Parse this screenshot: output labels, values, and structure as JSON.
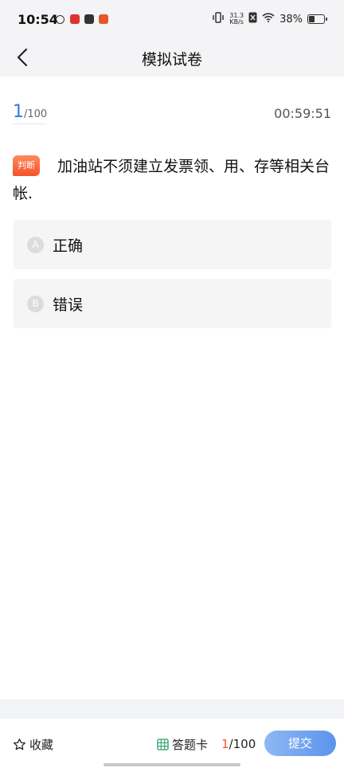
{
  "status_bar": {
    "time": "10:54",
    "network_speed_value": "31.3",
    "network_speed_unit": "KB/s",
    "battery": "38%",
    "battery_level": 0.38
  },
  "nav": {
    "title": "模拟试卷"
  },
  "progress": {
    "current": "1",
    "total": "/100",
    "timer": "00:59:51"
  },
  "question": {
    "type_badge": "判断",
    "text": "加油站不须建立发票领、用、存等相关台帐."
  },
  "options": [
    {
      "letter": "A",
      "text": "正确"
    },
    {
      "letter": "B",
      "text": "错误"
    }
  ],
  "bottom": {
    "favorite_label": "收藏",
    "answer_card_label": "答题卡",
    "counter_current": "1",
    "counter_total": "/100",
    "submit_label": "提交"
  },
  "colors": {
    "accent_blue": "#2f7be3",
    "badge_orange": "#f4532b",
    "submit_blue": "#5b93ec"
  }
}
